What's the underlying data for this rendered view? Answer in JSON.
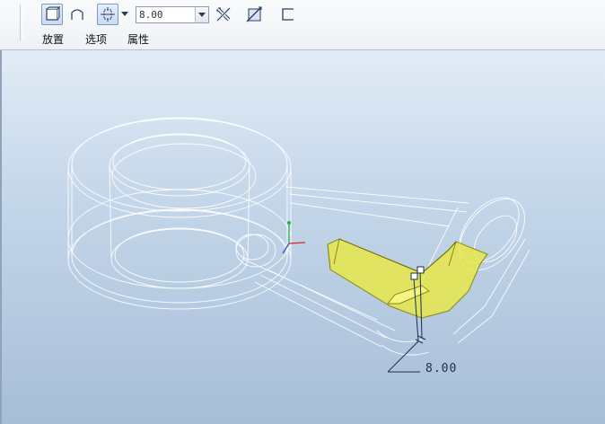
{
  "toolbar": {
    "tabs": [
      {
        "label": "放置"
      },
      {
        "label": "选项"
      },
      {
        "label": "属性"
      }
    ],
    "depth_value": "8.00",
    "icons": [
      "solid-icon",
      "surface-icon",
      "depth-blind-icon",
      "dropdown-arrow-icon",
      "flip-direction-icon",
      "remove-material-icon",
      "thicken-sketch-icon"
    ]
  },
  "viewport": {
    "dimension_label": "8.00",
    "feature_highlight_color": "#e8e84a",
    "wireframe_color": "#ffffff",
    "dimension_color": "#1b2f4f"
  }
}
